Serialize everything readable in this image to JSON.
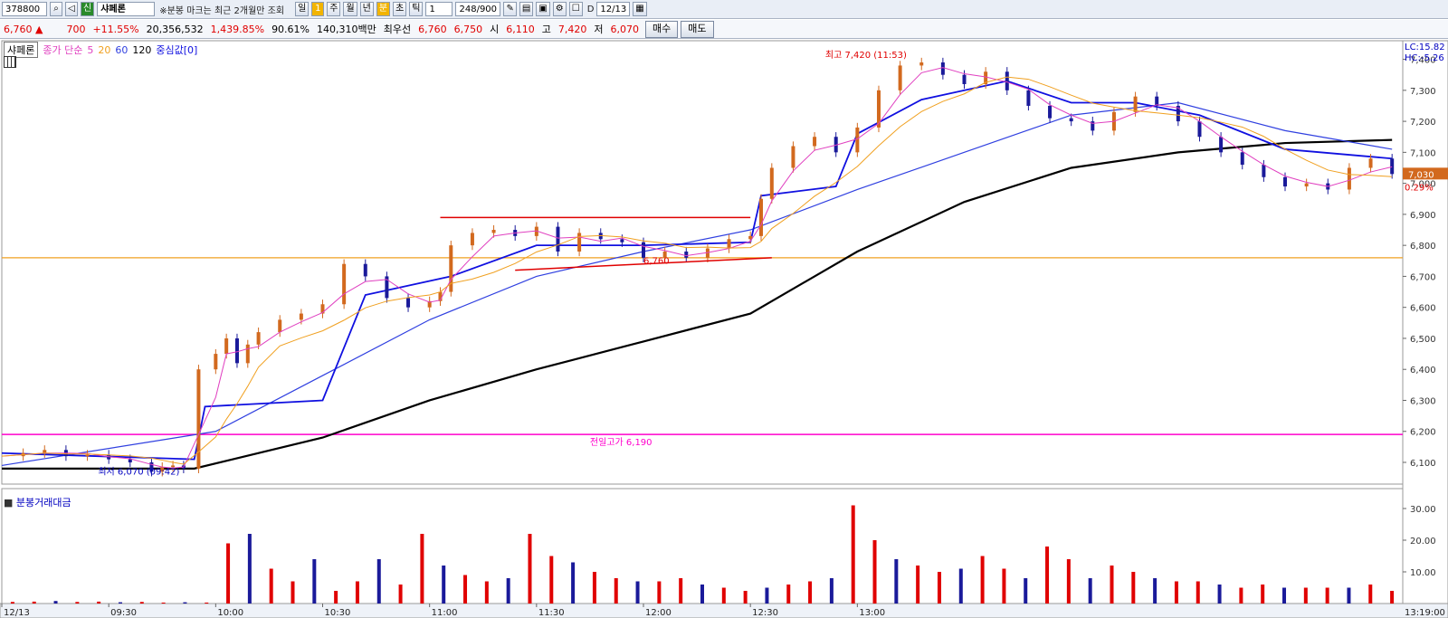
{
  "toolbar": {
    "code": "378800",
    "market_badge": "신",
    "name": "샤페론",
    "note": "※분봉 마크는 최근 2개월만 조회",
    "period_buttons": [
      "일",
      "1",
      "주",
      "월",
      "년",
      "분",
      "초",
      "틱"
    ],
    "selected_period": "분",
    "interval": "1",
    "count": "248/900",
    "checkbox_label": "D",
    "date": "12/13"
  },
  "quote": {
    "price": "6,760",
    "arrow": "▲",
    "change": "700",
    "change_pct": "+11.55%",
    "volume": "20,356,532",
    "vol_ratio": "1,439.85%",
    "turnover": "90.61%",
    "amount": "140,310백만",
    "best_label": "최우선",
    "ask": "6,760",
    "bid": "6,750",
    "open_label": "시",
    "open": "6,110",
    "high_label": "고",
    "high": "7,420",
    "low_label": "저",
    "low": "6,070",
    "buy_button": "매수",
    "sell_button": "매도"
  },
  "legend": {
    "name": "샤페론",
    "ma_label": "종가 단순",
    "ma5": "5",
    "ma20": "20",
    "ma60": "60",
    "ma120": "120",
    "center": "중심값[0]"
  },
  "annotations": {
    "high": "최고 7,420 (11:53)",
    "low": "최저 6,070 (09:42)",
    "prev_high": "전일고가 6,190",
    "trend_label": "6,760"
  },
  "right_axis": {
    "lc": "LC:15.82",
    "hc": "HC:-5.26",
    "current_price": "7,030",
    "current_pct": "0.29%"
  },
  "volume_panel": {
    "title": "분봉거래대금"
  },
  "colors": {
    "up": "#e00000",
    "candle_up": "#d2691e",
    "down": "#1a1a9a",
    "ma5": "#e040c0",
    "ma20": "#f0a020",
    "ma60": "#3040e0",
    "ma120": "#000000",
    "center": "#1010e0",
    "prev_high": "#ff00cc",
    "ref_line": "#f0a020"
  },
  "chart_data": {
    "type": "candlestick",
    "x_ticks": [
      "12/13",
      "09:30",
      "10:00",
      "10:30",
      "11:00",
      "11:30",
      "12:00",
      "12:30",
      "13:00",
      "13:19:00"
    ],
    "y_ticks": [
      "7,400",
      "7,300",
      "7,200",
      "7,100",
      "7,000",
      "6,900",
      "6,800",
      "6,700",
      "6,600",
      "6,500",
      "6,400",
      "6,300",
      "6,200",
      "6,100"
    ],
    "ylim": [
      6030,
      7460
    ],
    "volume_ticks": [
      "30.00",
      "20.00",
      "10.00"
    ],
    "volume_ylim": [
      0,
      34
    ],
    "prev_high_line": 6190,
    "ref_line": 6760,
    "price_path": [
      [
        9.0,
        6120
      ],
      [
        9.1,
        6130
      ],
      [
        9.2,
        6140
      ],
      [
        9.3,
        6120
      ],
      [
        9.4,
        6125
      ],
      [
        9.5,
        6110
      ],
      [
        9.6,
        6100
      ],
      [
        9.7,
        6070
      ],
      [
        9.75,
        6085
      ],
      [
        9.8,
        6090
      ],
      [
        9.85,
        6080
      ],
      [
        9.92,
        6400
      ],
      [
        10.0,
        6450
      ],
      [
        10.05,
        6500
      ],
      [
        10.1,
        6420
      ],
      [
        10.15,
        6480
      ],
      [
        10.2,
        6520
      ],
      [
        10.3,
        6560
      ],
      [
        10.4,
        6580
      ],
      [
        10.5,
        6610
      ],
      [
        10.6,
        6740
      ],
      [
        10.7,
        6700
      ],
      [
        10.8,
        6630
      ],
      [
        10.9,
        6600
      ],
      [
        11.0,
        6620
      ],
      [
        11.05,
        6650
      ],
      [
        11.1,
        6800
      ],
      [
        11.2,
        6840
      ],
      [
        11.3,
        6850
      ],
      [
        11.4,
        6830
      ],
      [
        11.5,
        6860
      ],
      [
        11.6,
        6780
      ],
      [
        11.7,
        6840
      ],
      [
        11.8,
        6820
      ],
      [
        11.9,
        6810
      ],
      [
        12.0,
        6760
      ],
      [
        12.1,
        6780
      ],
      [
        12.2,
        6760
      ],
      [
        12.3,
        6790
      ],
      [
        12.4,
        6820
      ],
      [
        12.5,
        6830
      ],
      [
        12.55,
        6950
      ],
      [
        12.6,
        7050
      ],
      [
        12.7,
        7120
      ],
      [
        12.8,
        7150
      ],
      [
        12.9,
        7100
      ],
      [
        13.0,
        7180
      ],
      [
        13.1,
        7300
      ],
      [
        13.2,
        7380
      ],
      [
        13.3,
        7390
      ],
      [
        13.4,
        7350
      ],
      [
        13.5,
        7320
      ],
      [
        13.6,
        7360
      ],
      [
        13.7,
        7300
      ],
      [
        13.8,
        7250
      ],
      [
        13.9,
        7210
      ],
      [
        14.0,
        7200
      ],
      [
        14.1,
        7170
      ],
      [
        14.2,
        7230
      ],
      [
        14.3,
        7280
      ],
      [
        14.4,
        7250
      ],
      [
        14.5,
        7200
      ],
      [
        14.6,
        7150
      ],
      [
        14.7,
        7100
      ],
      [
        14.8,
        7060
      ],
      [
        14.9,
        7020
      ],
      [
        15.0,
        6990
      ],
      [
        15.1,
        7000
      ],
      [
        15.2,
        6980
      ],
      [
        15.3,
        7050
      ],
      [
        15.4,
        7080
      ],
      [
        15.5,
        7030
      ]
    ],
    "ma60_path": [
      [
        9.0,
        6090
      ],
      [
        10.0,
        6200
      ],
      [
        10.5,
        6380
      ],
      [
        11.0,
        6560
      ],
      [
        11.5,
        6700
      ],
      [
        12.0,
        6780
      ],
      [
        12.5,
        6850
      ],
      [
        13.0,
        6980
      ],
      [
        13.5,
        7100
      ],
      [
        14.0,
        7220
      ],
      [
        14.5,
        7260
      ],
      [
        15.0,
        7170
      ],
      [
        15.5,
        7110
      ]
    ],
    "ma120_path": [
      [
        9.0,
        6080
      ],
      [
        9.9,
        6080
      ],
      [
        10.5,
        6180
      ],
      [
        11.0,
        6300
      ],
      [
        11.5,
        6400
      ],
      [
        12.0,
        6490
      ],
      [
        12.5,
        6580
      ],
      [
        13.0,
        6780
      ],
      [
        13.5,
        6940
      ],
      [
        14.0,
        7050
      ],
      [
        14.5,
        7100
      ],
      [
        15.0,
        7130
      ],
      [
        15.5,
        7140
      ]
    ],
    "center_path": [
      [
        9.0,
        6130
      ],
      [
        9.9,
        6110
      ],
      [
        9.95,
        6280
      ],
      [
        10.5,
        6300
      ],
      [
        10.7,
        6640
      ],
      [
        11.1,
        6700
      ],
      [
        11.5,
        6800
      ],
      [
        12.0,
        6800
      ],
      [
        12.5,
        6810
      ],
      [
        12.55,
        6960
      ],
      [
        12.9,
        6990
      ],
      [
        13.0,
        7160
      ],
      [
        13.3,
        7270
      ],
      [
        13.7,
        7330
      ],
      [
        14.0,
        7260
      ],
      [
        14.3,
        7260
      ],
      [
        14.6,
        7220
      ],
      [
        15.0,
        7110
      ],
      [
        15.5,
        7080
      ]
    ],
    "volume_values": [
      0.5,
      0.6,
      0.8,
      0.5,
      0.6,
      0.4,
      0.5,
      0.3,
      0.4,
      0.3,
      19,
      22,
      11,
      7,
      14,
      4,
      7,
      14,
      6,
      22,
      12,
      9,
      7,
      8,
      22,
      15,
      13,
      10,
      8,
      7,
      7,
      8,
      6,
      5,
      4,
      5,
      6,
      7,
      8,
      31,
      20,
      14,
      12,
      10,
      11,
      15,
      11,
      8,
      18,
      14,
      8,
      12,
      10,
      8,
      7,
      7,
      6,
      5,
      6,
      5,
      5,
      5,
      5,
      6,
      4
    ]
  }
}
